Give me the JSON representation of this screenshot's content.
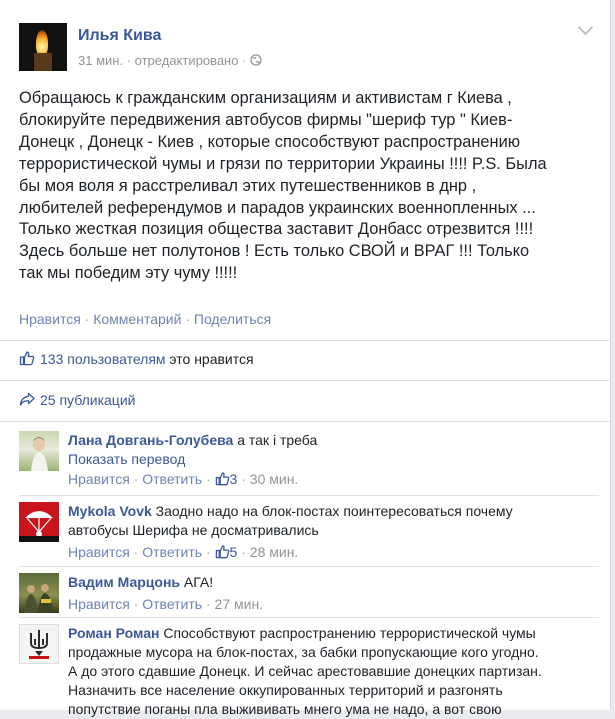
{
  "post": {
    "author": "Илья Кива",
    "time": "31 мин.",
    "edited": "отредактировано",
    "lines": [
      "Обращаюсь к гражданским организациям и активистам г Киева ,",
      "блокируйте передвижения автобусов фирмы \"шериф тур \" Киев-",
      "Донецк , Донецк - Киев , которые способствуют распространению",
      "террористической чумы и грязи по территории Украины !!!! P.S. Была",
      "бы моя воля я расстреливал этих путешественников в днр ,",
      "любителей референдумов и парадов украинских военнопленных ...",
      "Только жесткая позиция общества заставит Донбасс отрезвится !!!!",
      "Здесь больше нет полутонов ! Есть только СВОЙ и ВРАГ !!! Только",
      "так мы победим эту чуму !!!!!"
    ],
    "actions": {
      "like": "Нравится",
      "comment": "Комментарий",
      "share": "Поделиться"
    }
  },
  "likes": {
    "count_text": "133 пользователям",
    "suffix": "это нравится"
  },
  "shares": {
    "text": "25 публикаций"
  },
  "comment_actions": {
    "like": "Нравится",
    "reply": "Ответить"
  },
  "comments": [
    {
      "author": "Лана Довгань-Голубева",
      "text": "а так і треба",
      "translate": "Показать перевод",
      "likes": "3",
      "time": "30 мин."
    },
    {
      "author": "Mykola Vovk",
      "text_line1": "Заодно надо на блок-постах поинтересоваться почему",
      "text_line2": "автобусы Шерифа не досматривались",
      "likes": "5",
      "time": "28 мин."
    },
    {
      "author": "Вадим Марцонь",
      "text": "АГА!",
      "time": "27 мин."
    },
    {
      "author": "Роман Роман",
      "text_line1": "Способствуют распространению террористической чумы",
      "lines": [
        "продажные мусора на блок-постах, за бабки пропускающие кого угодно.",
        "А до этого сдавшие Донецк. И сейчас арестовавшие донецких партизан.",
        "Назначить все население оккупированных территорий и разгонять",
        "попутствие поганы пла выжививать мнего ума не надо, а вот свою"
      ]
    }
  ],
  "colors": {
    "link": "#3b5998",
    "action": "#6d84b4",
    "meta": "#90949c",
    "text": "#1d2129"
  },
  "icons": [
    "candle-avatar",
    "chevron-down-icon",
    "globe-icon",
    "thumbs-up-icon",
    "share-arrow-icon",
    "trident-icon",
    "paratrooper-icon"
  ]
}
